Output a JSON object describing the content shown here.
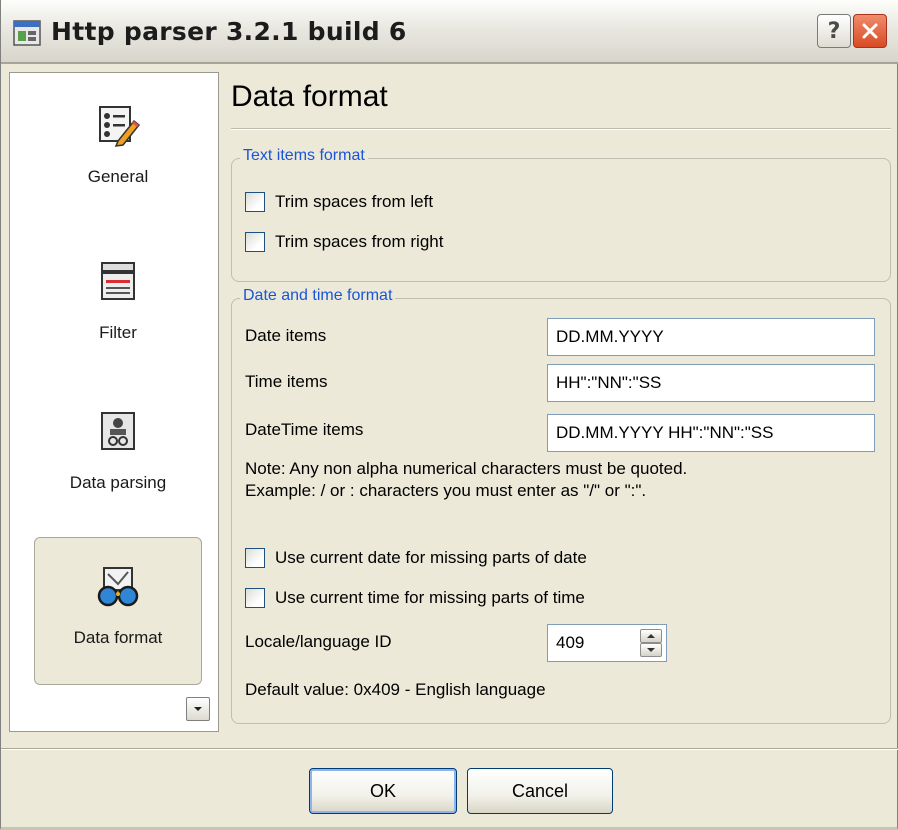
{
  "window": {
    "title": "Http parser 3.2.1 build 6",
    "help_label": "?",
    "close_label": "✕",
    "accent_color": "#1955d8"
  },
  "sidebar": {
    "items": [
      {
        "label": "General",
        "icon": "checklist-pencil-icon"
      },
      {
        "label": "Filter",
        "icon": "filter-tray-icon"
      },
      {
        "label": "Data parsing",
        "icon": "data-parsing-icon"
      },
      {
        "label": "Data format",
        "icon": "glasses-icon",
        "active": true
      }
    ],
    "scroll_icon": "chevron-down-icon"
  },
  "main": {
    "title": "Data format",
    "text_group": {
      "legend": "Text items format",
      "trim_left": {
        "label": "Trim spaces from left",
        "checked": false
      },
      "trim_right": {
        "label": "Trim spaces from right",
        "checked": false
      }
    },
    "date_group": {
      "legend": "Date and time format",
      "date_items": {
        "label": "Date items",
        "value": "DD.MM.YYYY"
      },
      "time_items": {
        "label": "Time items",
        "value": "HH\":\"NN\":\"SS"
      },
      "datetime_items": {
        "label": "DateTime items",
        "value": "DD.MM.YYYY HH\":\"NN\":\"SS"
      },
      "note_line1": "Note: Any non alpha numerical characters must be quoted.",
      "note_line2": "Example: / or : characters you must enter as \"/\" or \":\".",
      "use_current_date": {
        "label": "Use current date for missing parts of date",
        "checked": false
      },
      "use_current_time": {
        "label": "Use current time for missing parts of time",
        "checked": false
      },
      "locale": {
        "label": "Locale/language ID",
        "value": "409"
      },
      "default_value": "Default value: 0x409 - English language"
    }
  },
  "footer": {
    "ok_label": "OK",
    "cancel_label": "Cancel"
  }
}
